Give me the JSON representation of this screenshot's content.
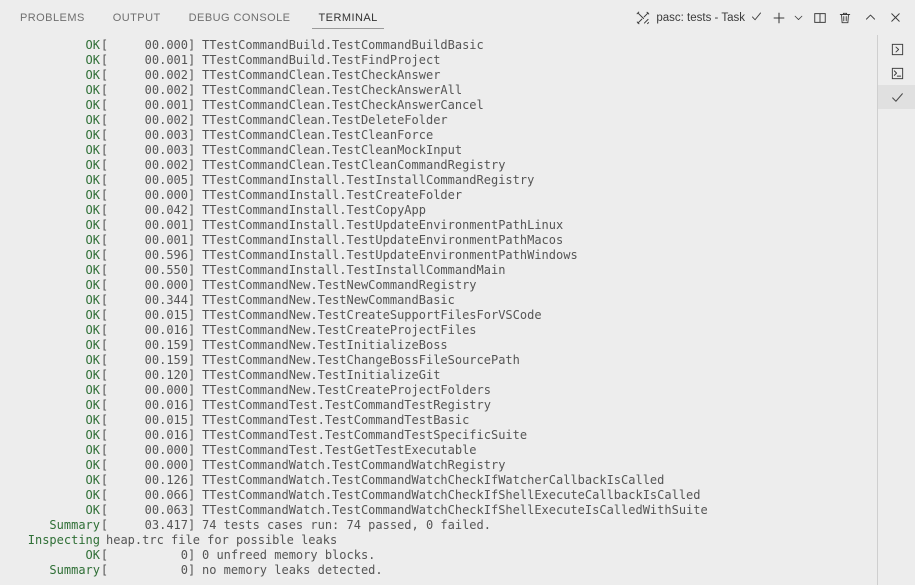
{
  "panel": {
    "tabs": [
      {
        "label": "PROBLEMS",
        "active": false,
        "name": "tab-problems"
      },
      {
        "label": "OUTPUT",
        "active": false,
        "name": "tab-output"
      },
      {
        "label": "DEBUG CONSOLE",
        "active": false,
        "name": "tab-debug-console"
      },
      {
        "label": "TERMINAL",
        "active": true,
        "name": "tab-terminal"
      }
    ],
    "actions": {
      "task_label": "pasc: tests - Task",
      "tools_icon": "tools-icon",
      "check_icon": "check-icon",
      "new_terminal_icon": "plus-icon",
      "new_terminal_dropdown_icon": "chevron-down-icon",
      "split_terminal_icon": "split-editor-icon",
      "kill_terminal_icon": "trash-icon",
      "maximize_icon": "chevron-up-icon",
      "close_panel_icon": "close-icon"
    }
  },
  "sidebar": {
    "items": [
      {
        "name": "sidebar-item-launch-profile",
        "icon": "chevron-right-box-icon",
        "selected": false
      },
      {
        "name": "sidebar-item-terminal-task",
        "icon": "terminal-box-icon",
        "selected": false
      },
      {
        "name": "sidebar-item-task-check",
        "icon": "check-icon",
        "selected": true
      }
    ]
  },
  "terminal": {
    "colors": {
      "background": "#ededed",
      "text": "#555555",
      "status_ok": "#2f6f36",
      "tab_active": "#333333",
      "tab_inactive": "#6f6f6f"
    },
    "lines": [
      {
        "status": "OK",
        "time": "00.000",
        "message": "TTestCommandBuild.TestCommandBuildBasic"
      },
      {
        "status": "OK",
        "time": "00.001",
        "message": "TTestCommandBuild.TestFindProject"
      },
      {
        "status": "OK",
        "time": "00.002",
        "message": "TTestCommandClean.TestCheckAnswer"
      },
      {
        "status": "OK",
        "time": "00.002",
        "message": "TTestCommandClean.TestCheckAnswerAll"
      },
      {
        "status": "OK",
        "time": "00.001",
        "message": "TTestCommandClean.TestCheckAnswerCancel"
      },
      {
        "status": "OK",
        "time": "00.002",
        "message": "TTestCommandClean.TestDeleteFolder"
      },
      {
        "status": "OK",
        "time": "00.003",
        "message": "TTestCommandClean.TestCleanForce"
      },
      {
        "status": "OK",
        "time": "00.003",
        "message": "TTestCommandClean.TestCleanMockInput"
      },
      {
        "status": "OK",
        "time": "00.002",
        "message": "TTestCommandClean.TestCleanCommandRegistry"
      },
      {
        "status": "OK",
        "time": "00.005",
        "message": "TTestCommandInstall.TestInstallCommandRegistry"
      },
      {
        "status": "OK",
        "time": "00.000",
        "message": "TTestCommandInstall.TestCreateFolder"
      },
      {
        "status": "OK",
        "time": "00.042",
        "message": "TTestCommandInstall.TestCopyApp"
      },
      {
        "status": "OK",
        "time": "00.001",
        "message": "TTestCommandInstall.TestUpdateEnvironmentPathLinux"
      },
      {
        "status": "OK",
        "time": "00.001",
        "message": "TTestCommandInstall.TestUpdateEnvironmentPathMacos"
      },
      {
        "status": "OK",
        "time": "00.596",
        "message": "TTestCommandInstall.TestUpdateEnvironmentPathWindows"
      },
      {
        "status": "OK",
        "time": "00.550",
        "message": "TTestCommandInstall.TestInstallCommandMain"
      },
      {
        "status": "OK",
        "time": "00.000",
        "message": "TTestCommandNew.TestNewCommandRegistry"
      },
      {
        "status": "OK",
        "time": "00.344",
        "message": "TTestCommandNew.TestNewCommandBasic"
      },
      {
        "status": "OK",
        "time": "00.015",
        "message": "TTestCommandNew.TestCreateSupportFilesForVSCode"
      },
      {
        "status": "OK",
        "time": "00.016",
        "message": "TTestCommandNew.TestCreateProjectFiles"
      },
      {
        "status": "OK",
        "time": "00.159",
        "message": "TTestCommandNew.TestInitializeBoss"
      },
      {
        "status": "OK",
        "time": "00.159",
        "message": "TTestCommandNew.TestChangeBossFileSourcePath"
      },
      {
        "status": "OK",
        "time": "00.120",
        "message": "TTestCommandNew.TestInitializeGit"
      },
      {
        "status": "OK",
        "time": "00.000",
        "message": "TTestCommandNew.TestCreateProjectFolders"
      },
      {
        "status": "OK",
        "time": "00.016",
        "message": "TTestCommandTest.TestCommandTestRegistry"
      },
      {
        "status": "OK",
        "time": "00.015",
        "message": "TTestCommandTest.TestCommandTestBasic"
      },
      {
        "status": "OK",
        "time": "00.016",
        "message": "TTestCommandTest.TestCommandTestSpecificSuite"
      },
      {
        "status": "OK",
        "time": "00.000",
        "message": "TTestCommandTest.TestGetTestExecutable"
      },
      {
        "status": "OK",
        "time": "00.000",
        "message": "TTestCommandWatch.TestCommandWatchRegistry"
      },
      {
        "status": "OK",
        "time": "00.126",
        "message": "TTestCommandWatch.TestCommandWatchCheckIfWatcherCallbackIsCalled"
      },
      {
        "status": "OK",
        "time": "00.066",
        "message": "TTestCommandWatch.TestCommandWatchCheckIfShellExecuteCallbackIsCalled"
      },
      {
        "status": "OK",
        "time": "00.063",
        "message": "TTestCommandWatch.TestCommandWatchCheckIfShellExecuteIsCalledWithSuite"
      },
      {
        "status": "Summary",
        "time": "03.417",
        "message": "74 tests cases run: 74 passed, 0 failed."
      },
      {
        "status": "Inspecting",
        "plain": "heap.trc file for possible leaks"
      },
      {
        "status": "OK",
        "time": "0",
        "message": "0 unfreed memory blocks."
      },
      {
        "status": "Summary",
        "time": "0",
        "message": "no memory leaks detected."
      }
    ]
  }
}
